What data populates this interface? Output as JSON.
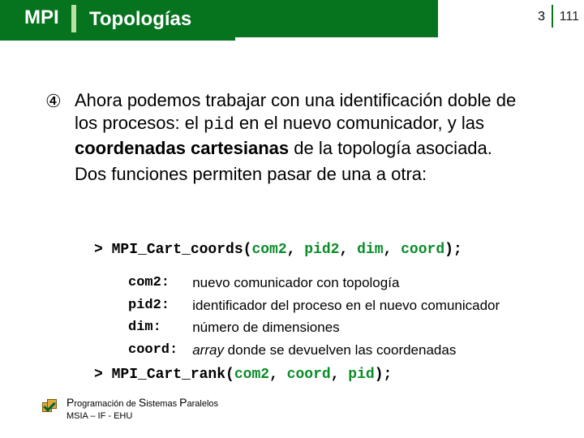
{
  "header": {
    "mpi": "MPI",
    "title": "Topologías"
  },
  "pager": {
    "current": "3",
    "total": "111"
  },
  "bullet_symbol": "④",
  "paragraph": {
    "t1": "Ahora podemos trabajar con una identificación doble de los procesos: el ",
    "code": "pid",
    "t2": " en el nuevo comunicador, y las ",
    "bold": "coordenadas cartesianas",
    "t3": " de la topología asociada."
  },
  "paragraph2": "Dos funciones permiten pasar de una a otra:",
  "code1": {
    "caret": "> ",
    "fn": "MPI_Cart_coords(",
    "a1": "com2",
    "sep": ", ",
    "a2": "pid2",
    "a3": "dim",
    "a4": "coord",
    "close": ");"
  },
  "params": [
    {
      "key": "com2:",
      "val": "nuevo comunicador con topología"
    },
    {
      "key": "pid2:",
      "val": "identificador del proceso en el nuevo comunicador"
    },
    {
      "key": "dim:",
      "val": "número de dimensiones"
    },
    {
      "key": "coord:",
      "val_leading_ital": "array",
      "val_rest": " donde se devuelven las coordenadas"
    }
  ],
  "code2": {
    "caret": "> ",
    "fn": "MPI_Cart_rank(",
    "a1": "com2",
    "sep": ", ",
    "a2": "coord",
    "a3": "pid",
    "close": ");"
  },
  "footer": {
    "line1_parts": [
      "P",
      "rogramación de ",
      "S",
      "istemas ",
      "P",
      "aralelos"
    ],
    "line2": "MSIA – IF - EHU"
  }
}
